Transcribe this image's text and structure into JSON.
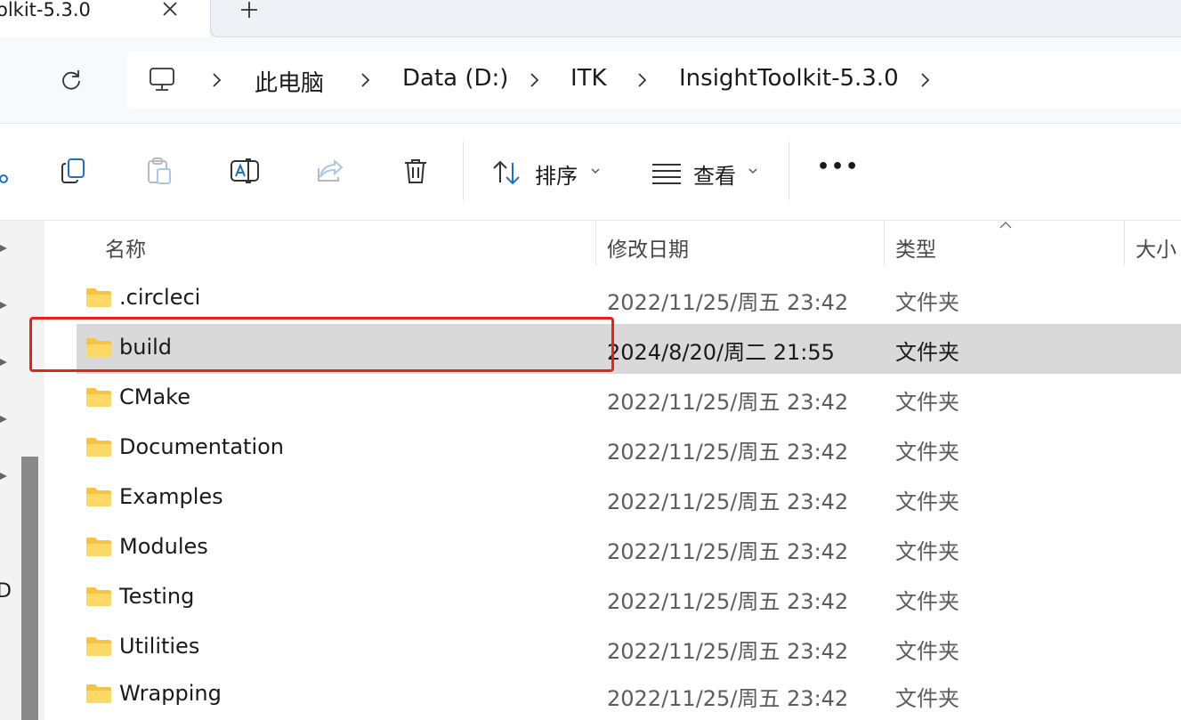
{
  "tab": {
    "title": "olkit-5.3.0"
  },
  "breadcrumb": {
    "items": [
      {
        "label": "此电脑"
      },
      {
        "label": "Data (D:)"
      },
      {
        "label": "ITK"
      },
      {
        "label": "InsightToolkit-5.3.0"
      }
    ]
  },
  "toolbar": {
    "sort_label": "排序",
    "view_label": "查看",
    "more_label": "•••"
  },
  "left_pane": {
    "partial_text": "D"
  },
  "columns": {
    "name": "名称",
    "modified": "修改日期",
    "type": "类型",
    "size": "大小"
  },
  "files": [
    {
      "name": ".circleci",
      "modified": "2022/11/25/周五 23:42",
      "type": "文件夹"
    },
    {
      "name": "build",
      "modified": "2024/8/20/周二 21:55",
      "type": "文件夹",
      "selected": true
    },
    {
      "name": "CMake",
      "modified": "2022/11/25/周五 23:42",
      "type": "文件夹"
    },
    {
      "name": "Documentation",
      "modified": "2022/11/25/周五 23:42",
      "type": "文件夹"
    },
    {
      "name": "Examples",
      "modified": "2022/11/25/周五 23:42",
      "type": "文件夹"
    },
    {
      "name": "Modules",
      "modified": "2022/11/25/周五 23:42",
      "type": "文件夹"
    },
    {
      "name": "Testing",
      "modified": "2022/11/25/周五 23:42",
      "type": "文件夹"
    },
    {
      "name": "Utilities",
      "modified": "2022/11/25/周五 23:42",
      "type": "文件夹"
    },
    {
      "name": "Wrapping",
      "modified": "2022/11/25/周五 23:42",
      "type": "文件夹"
    }
  ],
  "colors": {
    "selection": "#d9d9d9",
    "highlight_box": "#e2231f",
    "folder": "#f6c344",
    "accent": "#1f6fc5"
  }
}
